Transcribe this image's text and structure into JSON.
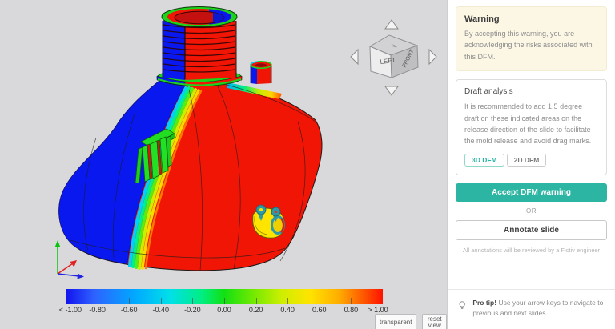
{
  "canvas": {
    "scale": {
      "labels": [
        "< -1.00",
        "-0.80",
        "-0.60",
        "-0.40",
        "-0.20",
        "0.00",
        "0.20",
        "0.40",
        "0.60",
        "0.80",
        "> 1.00"
      ]
    },
    "buttons": {
      "transparent": "transparent",
      "reset_view": "reset view"
    },
    "viewcube": {
      "left": "LEFT",
      "front": "FRONT",
      "top": "TOP"
    }
  },
  "panel": {
    "warning": {
      "title": "Warning",
      "body": "By accepting this warning, you are acknowledging the risks associated with this DFM."
    },
    "draft": {
      "title": "Draft analysis",
      "body": "It is recommended to add 1.5 degree draft on these indicated areas on the release direction of the slide to facilitate the mold release and avoid drag marks.",
      "tab_3d": "3D DFM",
      "tab_2d": "2D DFM"
    },
    "accept_label": "Accept DFM warning",
    "or_label": "OR",
    "annotate_label": "Annotate slide",
    "note": "All annotations will be reviewed by a Fictiv engineer",
    "protip": {
      "title": "Pro tip!",
      "text": "Use your arrow keys to navigate to previous and next slides."
    }
  },
  "colors": {
    "accent_teal": "#2bb5a2",
    "draft_positive_red": "#f01505",
    "draft_negative_blue": "#0a18f0",
    "draft_zero_green": "#1bd41b",
    "canvas_bg": "#d9d9db",
    "warning_bg": "#fcf7e5"
  }
}
